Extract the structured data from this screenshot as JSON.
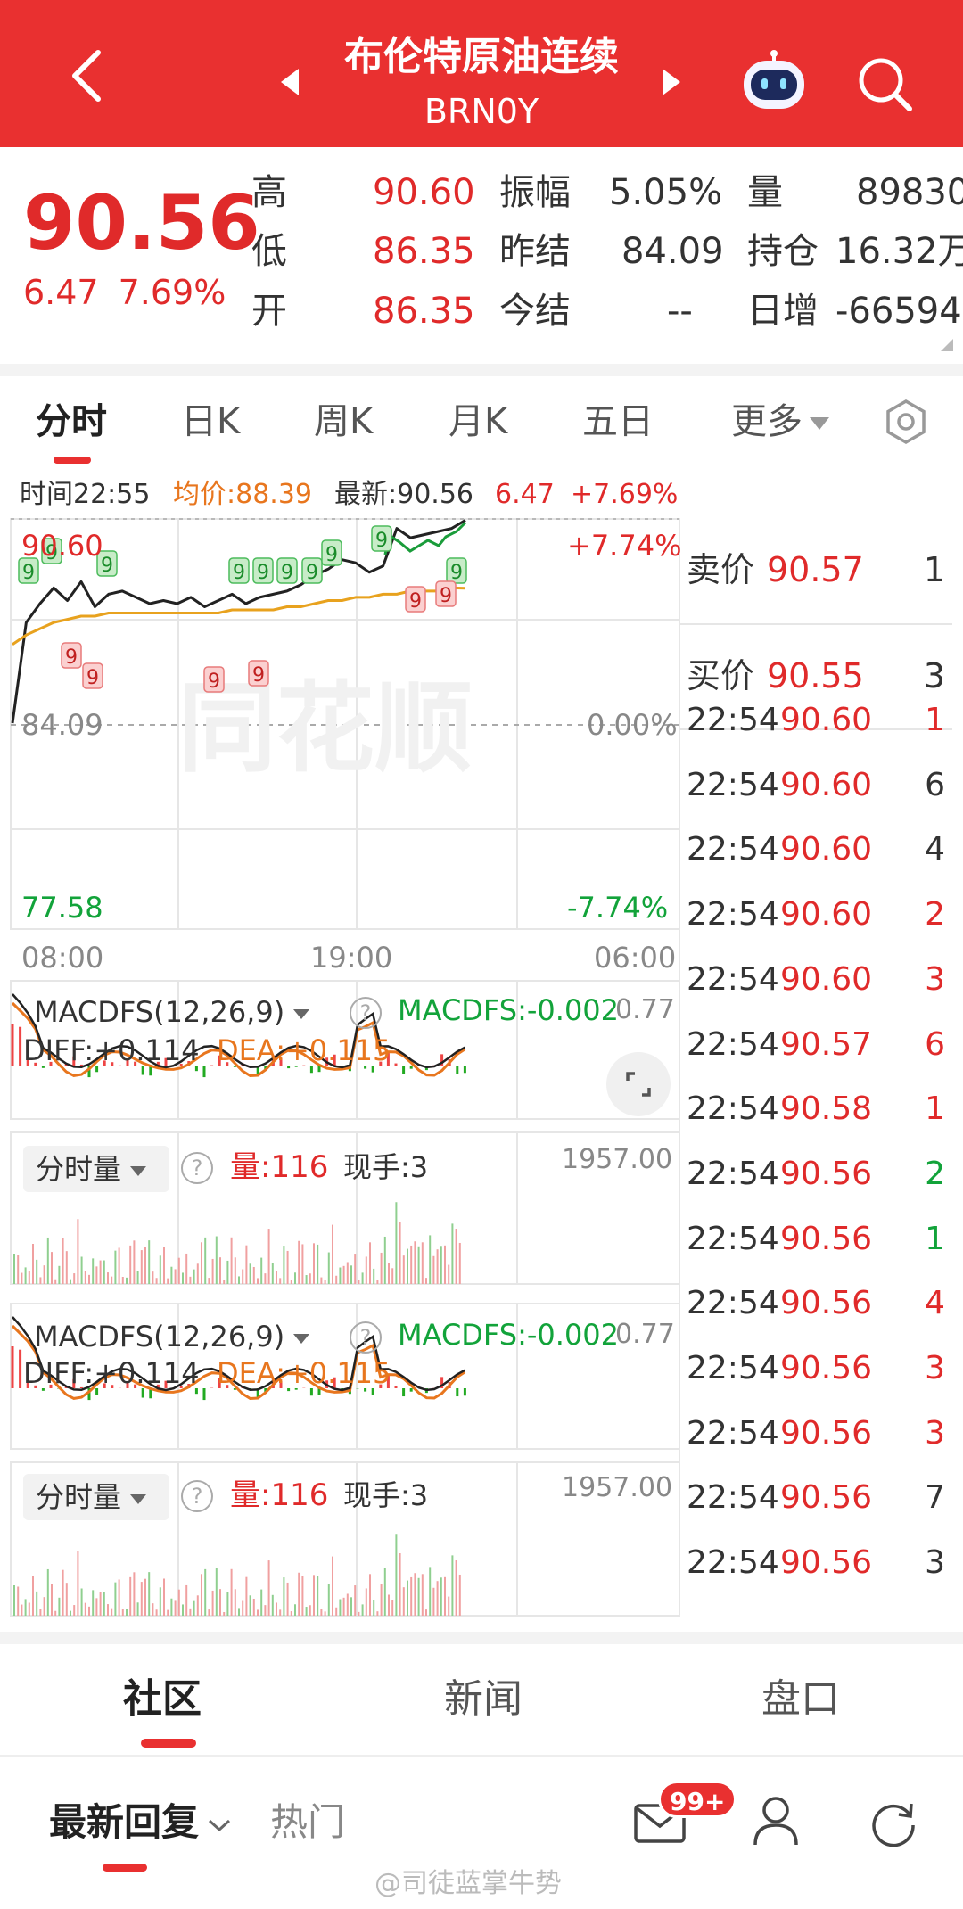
{
  "header": {
    "title": "布伦特原油连续",
    "code": "BRN0Y"
  },
  "quote": {
    "price": "90.56",
    "change": "6.47",
    "change_pct": "7.69%",
    "high_label": "高",
    "high": "90.60",
    "low_label": "低",
    "low": "86.35",
    "open_label": "开",
    "open": "86.35",
    "amplitude_label": "振幅",
    "amplitude": "5.05%",
    "prev_settle_label": "昨结",
    "prev_settle": "84.09",
    "settle_label": "今结",
    "settle": "--",
    "volume_label": "量",
    "volume": "89830",
    "oi_label": "持仓",
    "oi": "16.32万",
    "daily_inc_label": "日增",
    "daily_inc": "-66594"
  },
  "tabs": [
    {
      "label": "分时"
    },
    {
      "label": "日K"
    },
    {
      "label": "周K"
    },
    {
      "label": "月K"
    },
    {
      "label": "五日"
    },
    {
      "label": "更多"
    }
  ],
  "info": {
    "time": "时间22:55",
    "avg": "均价:88.39",
    "latest": "最新:90.56",
    "chg": "6.47",
    "pct": "+7.69%"
  },
  "chart": {
    "top_price": "90.60",
    "top_pct": "+7.74%",
    "mid_price": "84.09",
    "mid_pct": "0.00%",
    "bottom_price": "77.58",
    "bottom_pct": "-7.74%",
    "t_start": "08:00",
    "t_mid": "19:00",
    "t_end": "06:00",
    "watermark": "同花顺",
    "marker": "9"
  },
  "chart_data": {
    "type": "line",
    "title": "",
    "xlabel": "",
    "ylabel": "",
    "x_ticks": [
      "08:00",
      "19:00",
      "06:00"
    ],
    "ylim": [
      77.58,
      90.6
    ],
    "series": [
      {
        "name": "price",
        "values": [
          84.09,
          87.3,
          87.9,
          88.4,
          88.0,
          88.6,
          87.8,
          88.2,
          88.3,
          88.1,
          87.9,
          88.0,
          87.9,
          88.1,
          87.8,
          88.0,
          88.2,
          87.9,
          88.1,
          88.2,
          88.3,
          88.5,
          88.8,
          89.0,
          89.3,
          89.2,
          88.9,
          89.1,
          90.3,
          90.0,
          90.1,
          90.2,
          90.3,
          90.56
        ]
      },
      {
        "name": "avg",
        "values": [
          86.6,
          86.9,
          87.1,
          87.3,
          87.4,
          87.5,
          87.5,
          87.6,
          87.6,
          87.6,
          87.6,
          87.6,
          87.6,
          87.6,
          87.6,
          87.6,
          87.7,
          87.7,
          87.7,
          87.7,
          87.8,
          87.8,
          87.9,
          88.0,
          88.0,
          88.1,
          88.1,
          88.2,
          88.2,
          88.3,
          88.3,
          88.3,
          88.4,
          88.39
        ]
      }
    ]
  },
  "macd": {
    "selector": "MACDFS(12,26,9)",
    "value": "MACDFS:-0.002",
    "diff": "DIFF:+0.114",
    "dea": "DEA:+0.115",
    "right": "0.77"
  },
  "volume": {
    "selector": "分时量",
    "qty": "量:116",
    "hand": "现手:3",
    "max": "1957.00"
  },
  "orderbook": {
    "sell_label": "卖价",
    "sell_price": "90.57",
    "sell_vol": "1",
    "buy_label": "买价",
    "buy_price": "90.55",
    "buy_vol": "3",
    "ticks": [
      {
        "t": "22:54",
        "p": "90.60",
        "v": "1",
        "c": "red"
      },
      {
        "t": "22:54",
        "p": "90.60",
        "v": "6",
        "c": "dark"
      },
      {
        "t": "22:54",
        "p": "90.60",
        "v": "4",
        "c": "dark"
      },
      {
        "t": "22:54",
        "p": "90.60",
        "v": "2",
        "c": "red"
      },
      {
        "t": "22:54",
        "p": "90.60",
        "v": "3",
        "c": "red"
      },
      {
        "t": "22:54",
        "p": "90.57",
        "v": "6",
        "c": "red"
      },
      {
        "t": "22:54",
        "p": "90.58",
        "v": "1",
        "c": "red"
      },
      {
        "t": "22:54",
        "p": "90.56",
        "v": "2",
        "c": "green"
      },
      {
        "t": "22:54",
        "p": "90.56",
        "v": "1",
        "c": "green"
      },
      {
        "t": "22:54",
        "p": "90.56",
        "v": "4",
        "c": "red"
      },
      {
        "t": "22:54",
        "p": "90.56",
        "v": "3",
        "c": "red"
      },
      {
        "t": "22:54",
        "p": "90.56",
        "v": "3",
        "c": "red"
      },
      {
        "t": "22:54",
        "p": "90.56",
        "v": "7",
        "c": "dark"
      },
      {
        "t": "22:54",
        "p": "90.56",
        "v": "3",
        "c": "dark"
      }
    ]
  },
  "subtabs": [
    {
      "label": "社区"
    },
    {
      "label": "新闻"
    },
    {
      "label": "盘口"
    }
  ],
  "bottom": {
    "latest_reply": "最新回复",
    "hot": "热门",
    "badge": "99+",
    "watermark": "@司徒蓝掌牛势"
  },
  "colors": {
    "brand": "#e93030",
    "up": "#e02a2a",
    "down": "#12a33a",
    "avg": "#e8a21e"
  }
}
